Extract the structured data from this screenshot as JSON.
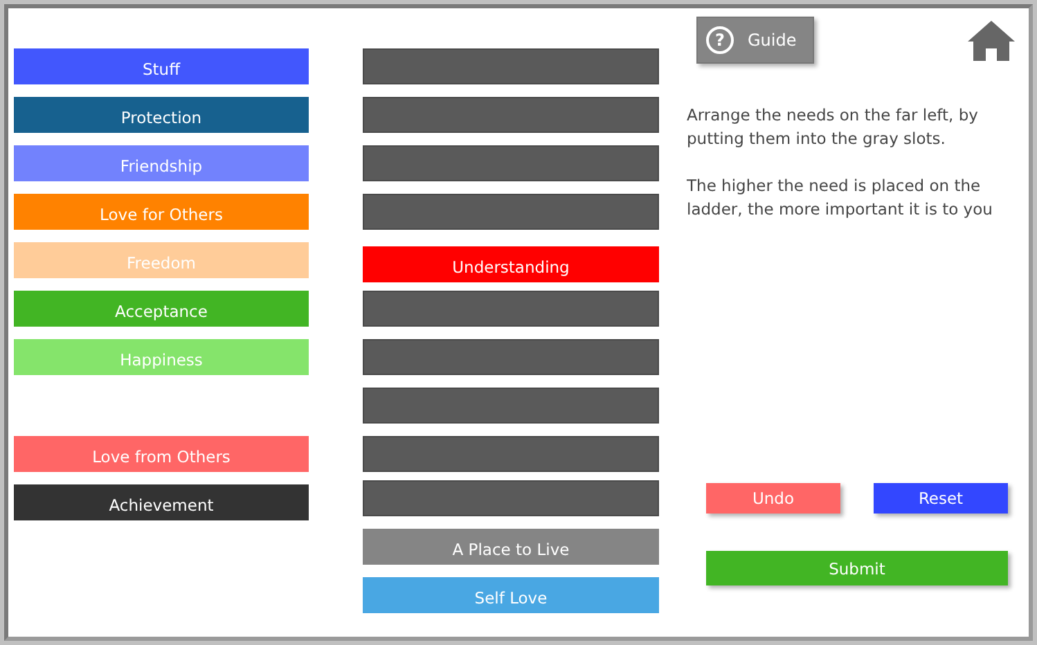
{
  "needs": [
    {
      "kind": "need",
      "label": "Stuff",
      "color": "#4257fd"
    },
    {
      "kind": "need",
      "label": "Protection",
      "color": "#17618f"
    },
    {
      "kind": "need",
      "label": "Friendship",
      "color": "#7282fd"
    },
    {
      "kind": "need",
      "label": "Love for Others",
      "color": "#ff8200"
    },
    {
      "kind": "need",
      "label": "Freedom",
      "color": "#ffcc99"
    },
    {
      "kind": "need",
      "label": "Acceptance",
      "color": "#42b524"
    },
    {
      "kind": "need",
      "label": "Happiness",
      "color": "#85e46b"
    },
    {
      "kind": "empty"
    },
    {
      "kind": "need",
      "label": "Love from Others",
      "color": "#ff6666"
    },
    {
      "kind": "need",
      "label": "Achievement",
      "color": "#333333"
    }
  ],
  "ladder": [
    {
      "kind": "slot"
    },
    {
      "kind": "slot"
    },
    {
      "kind": "slot"
    },
    {
      "kind": "slot"
    },
    {
      "kind": "need",
      "label": "Understanding",
      "color": "#ff0000"
    },
    {
      "kind": "slot"
    },
    {
      "kind": "slot"
    },
    {
      "kind": "slot"
    },
    {
      "kind": "slot"
    },
    {
      "kind": "slot"
    },
    {
      "kind": "need",
      "label": "A Place to Live",
      "color": "#858585"
    },
    {
      "kind": "need",
      "label": "Self Love",
      "color": "#49a7e3"
    }
  ],
  "guide_button": {
    "icon": "?",
    "label": "Guide"
  },
  "instructions": [
    "Arrange the needs on the far left, by putting them into the gray slots.",
    "The higher the need is placed on the ladder, the more important it is to you"
  ],
  "buttons": [
    {
      "kind": "undo",
      "label": "Undo",
      "color": "#ff6666"
    },
    {
      "kind": "reset",
      "label": "Reset",
      "color": "#3347ff"
    },
    {
      "kind": "submit",
      "label": "Submit",
      "color": "#42b524"
    }
  ]
}
